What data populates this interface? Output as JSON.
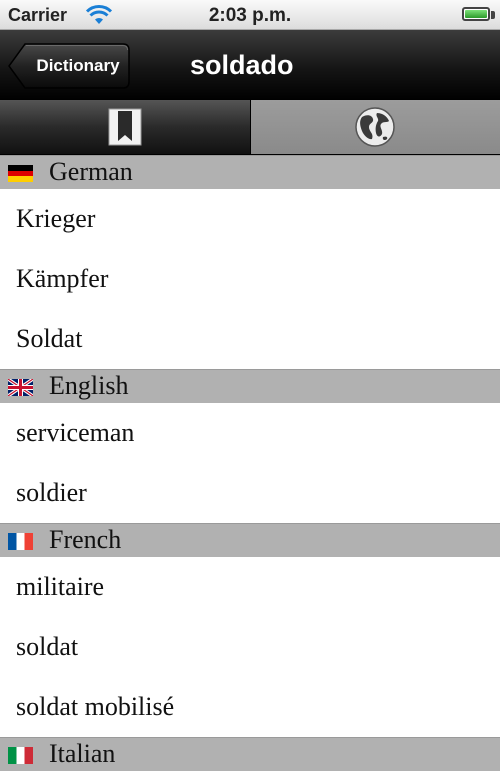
{
  "status": {
    "carrier": "Carrier",
    "time": "2:03 p.m."
  },
  "nav": {
    "back_label": "Dictionary",
    "title": "soldado"
  },
  "tabs": [
    {
      "icon": "bookmark-icon",
      "selected": false
    },
    {
      "icon": "globe-icon",
      "selected": true
    }
  ],
  "sections": [
    {
      "language": "German",
      "flag": "german-flag-icon",
      "words": [
        "Krieger",
        "Kämpfer",
        "Soldat"
      ]
    },
    {
      "language": "English",
      "flag": "uk-flag-icon",
      "words": [
        "serviceman",
        "soldier"
      ]
    },
    {
      "language": "French",
      "flag": "french-flag-icon",
      "words": [
        "militaire",
        "soldat",
        "soldat mobilisé"
      ]
    },
    {
      "language": "Italian",
      "flag": "italian-flag-icon",
      "words": []
    }
  ]
}
